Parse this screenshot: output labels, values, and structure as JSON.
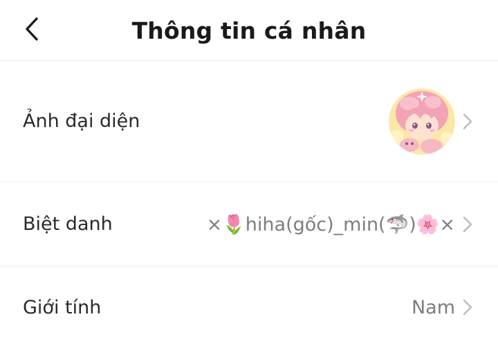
{
  "header": {
    "title": "Thông tin cá nhân",
    "back_icon": "chevron-left-icon"
  },
  "rows": [
    {
      "label": "Ảnh đại diện",
      "value": "",
      "icon": "chevron-right-icon"
    },
    {
      "label": "Biệt danh",
      "value": "×🌷hiha(gốc)_min(🦈)🌸×",
      "icon": "chevron-right-icon"
    },
    {
      "label": "Giới tính",
      "value": "Nam",
      "icon": "chevron-right-icon"
    }
  ],
  "colors": {
    "text_primary": "#222222",
    "text_secondary": "#7d7d7d",
    "divider": "#ececec",
    "chevron": "#bdbdbd"
  }
}
